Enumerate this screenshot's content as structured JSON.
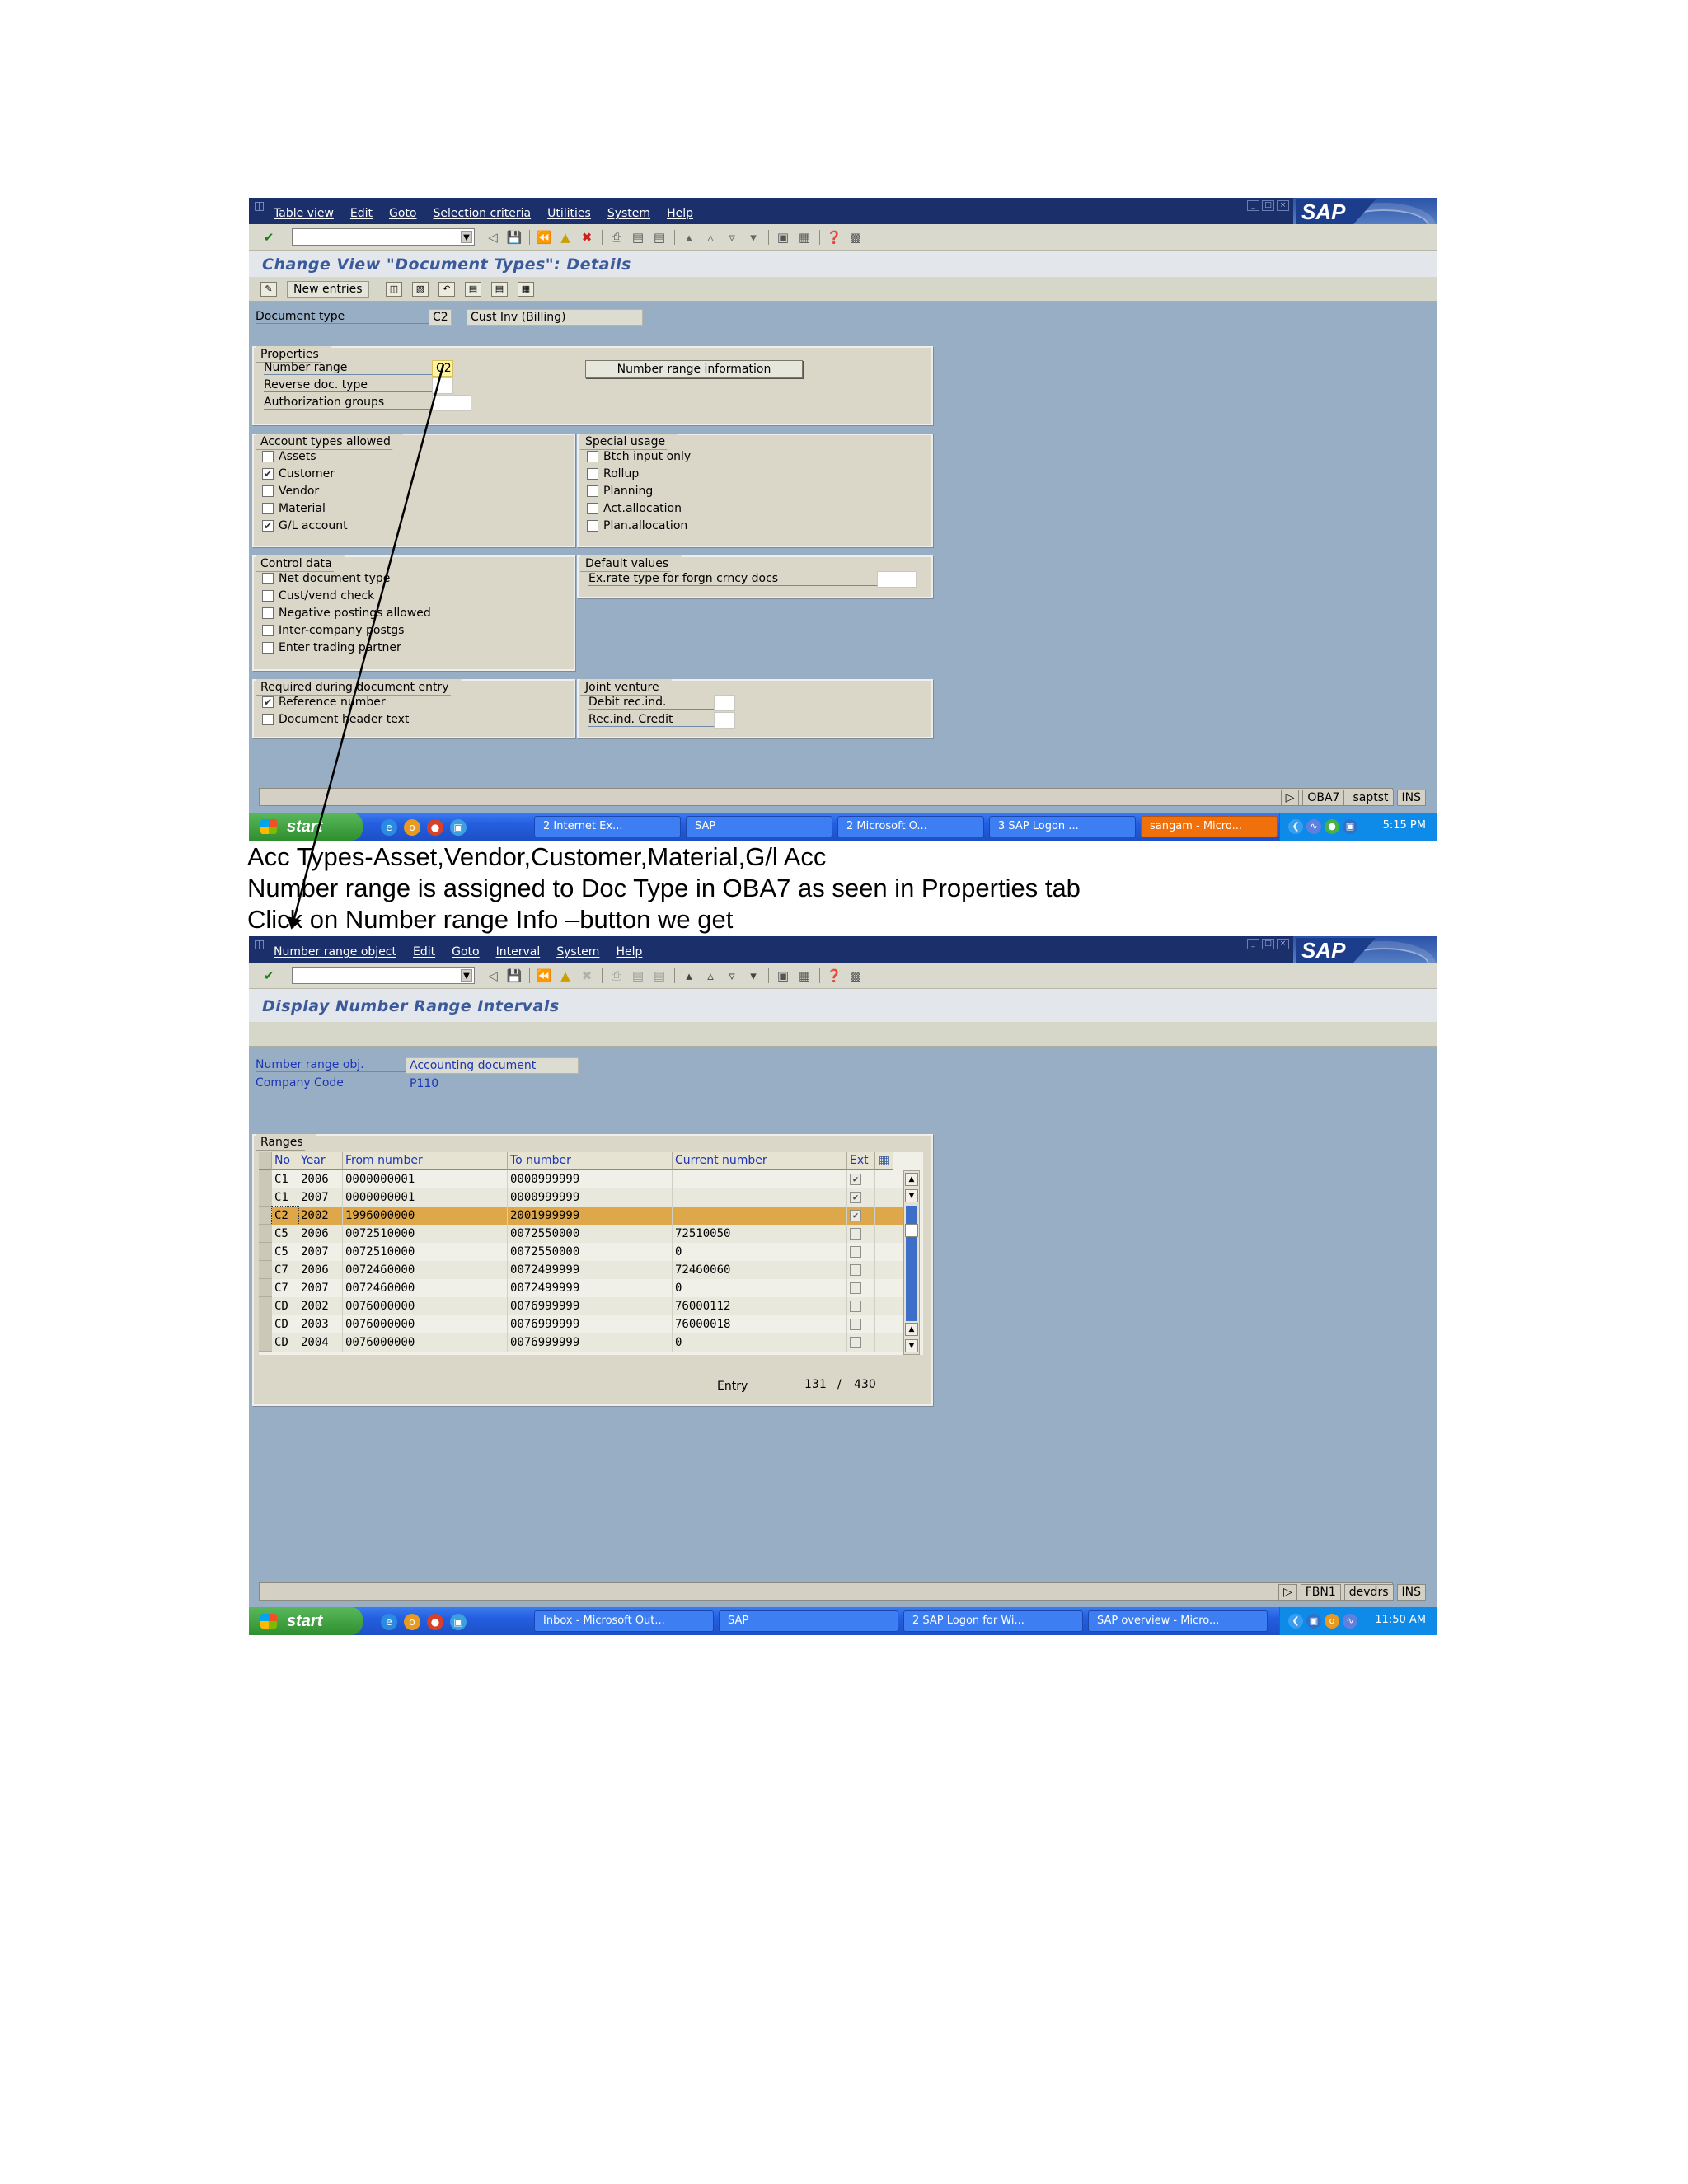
{
  "screen1": {
    "menu": [
      "Table view",
      "Edit",
      "Goto",
      "Selection criteria",
      "Utilities",
      "System",
      "Help"
    ],
    "title": "Change View \"Document Types\": Details",
    "app_toolbar": {
      "new_entries": "New entries"
    },
    "document_type": {
      "label": "Document type",
      "code": "C2",
      "text": "Cust Inv (Billing)"
    },
    "properties": {
      "title": "Properties",
      "number_range": {
        "label": "Number range",
        "value": "C2"
      },
      "reverse_doc_type": {
        "label": "Reverse doc. type",
        "value": ""
      },
      "authorization_groups": {
        "label": "Authorization groups",
        "value": ""
      },
      "button": "Number range information"
    },
    "account_types": {
      "title": "Account types allowed",
      "items": [
        {
          "label": "Assets",
          "checked": false
        },
        {
          "label": "Customer",
          "checked": true
        },
        {
          "label": "Vendor",
          "checked": false
        },
        {
          "label": "Material",
          "checked": false
        },
        {
          "label": "G/L account",
          "checked": true
        }
      ]
    },
    "special_usage": {
      "title": "Special usage",
      "items": [
        {
          "label": "Btch input only",
          "checked": false
        },
        {
          "label": "Rollup",
          "checked": false
        },
        {
          "label": "Planning",
          "checked": false
        },
        {
          "label": "Act.allocation",
          "checked": false
        },
        {
          "label": "Plan.allocation",
          "checked": false
        }
      ]
    },
    "control_data": {
      "title": "Control data",
      "items": [
        {
          "label": "Net document type",
          "checked": false
        },
        {
          "label": "Cust/vend check",
          "checked": false
        },
        {
          "label": "Negative postings allowed",
          "checked": false
        },
        {
          "label": "Inter-company postgs",
          "checked": false
        },
        {
          "label": "Enter trading partner",
          "checked": false
        }
      ]
    },
    "default_values": {
      "title": "Default values",
      "exrate_label": "Ex.rate type for forgn crncy docs",
      "exrate_value": ""
    },
    "required_entry": {
      "title": "Required during document entry",
      "items": [
        {
          "label": "Reference number",
          "checked": true
        },
        {
          "label": "Document header text",
          "checked": false
        }
      ]
    },
    "joint_venture": {
      "title": "Joint venture",
      "debit_label": "Debit rec.ind.",
      "credit_label": "Rec.ind. Credit"
    },
    "status": [
      "OBA7",
      "saptst",
      "INS"
    ],
    "taskbar": {
      "start": "start",
      "tasks": [
        "2 Internet Ex...",
        "SAP",
        "2 Microsoft O...",
        "3 SAP Logon ...",
        "sangam - Micro..."
      ],
      "clock": "5:15 PM"
    }
  },
  "captions": [
    "Acc Types-Asset,Vendor,Customer,Material,G/l Acc",
    "Number range is assigned to Doc Type in OBA7 as seen in Properties tab",
    "Click on  Number range Info –button we get"
  ],
  "screen2": {
    "menu": [
      "Number range object",
      "Edit",
      "Goto",
      "Interval",
      "System",
      "Help"
    ],
    "title": "Display Number Range Intervals",
    "number_range_obj": {
      "label": "Number range obj.",
      "value": "Accounting document"
    },
    "company_code": {
      "label": "Company Code",
      "value": "P110"
    },
    "ranges_title": "Ranges",
    "columns": [
      "No",
      "Year",
      "From number",
      "To number",
      "Current number",
      "Ext"
    ],
    "rows": [
      {
        "no": "C1",
        "year": "2006",
        "from": "0000000001",
        "to": "0000999999",
        "current": "",
        "ext": true
      },
      {
        "no": "C1",
        "year": "2007",
        "from": "0000000001",
        "to": "0000999999",
        "current": "",
        "ext": true
      },
      {
        "no": "C2",
        "year": "2002",
        "from": "1996000000",
        "to": "2001999999",
        "current": "",
        "ext": true
      },
      {
        "no": "C5",
        "year": "2006",
        "from": "0072510000",
        "to": "0072550000",
        "current": "72510050",
        "ext": false
      },
      {
        "no": "C5",
        "year": "2007",
        "from": "0072510000",
        "to": "0072550000",
        "current": "0",
        "ext": false
      },
      {
        "no": "C7",
        "year": "2006",
        "from": "0072460000",
        "to": "0072499999",
        "current": "72460060",
        "ext": false
      },
      {
        "no": "C7",
        "year": "2007",
        "from": "0072460000",
        "to": "0072499999",
        "current": "0",
        "ext": false
      },
      {
        "no": "CD",
        "year": "2002",
        "from": "0076000000",
        "to": "0076999999",
        "current": "76000112",
        "ext": false
      },
      {
        "no": "CD",
        "year": "2003",
        "from": "0076000000",
        "to": "0076999999",
        "current": "76000018",
        "ext": false
      },
      {
        "no": "CD",
        "year": "2004",
        "from": "0076000000",
        "to": "0076999999",
        "current": "0",
        "ext": false
      }
    ],
    "entry": {
      "label": "Entry",
      "current": "131",
      "sep": "/",
      "total": "430"
    },
    "status": [
      "FBN1",
      "devdrs",
      "INS"
    ],
    "taskbar": {
      "start": "start",
      "tasks": [
        "Inbox - Microsoft Out...",
        "SAP",
        "2 SAP Logon for Wi...",
        "SAP overview - Micro..."
      ],
      "clock": "11:50 AM"
    }
  }
}
